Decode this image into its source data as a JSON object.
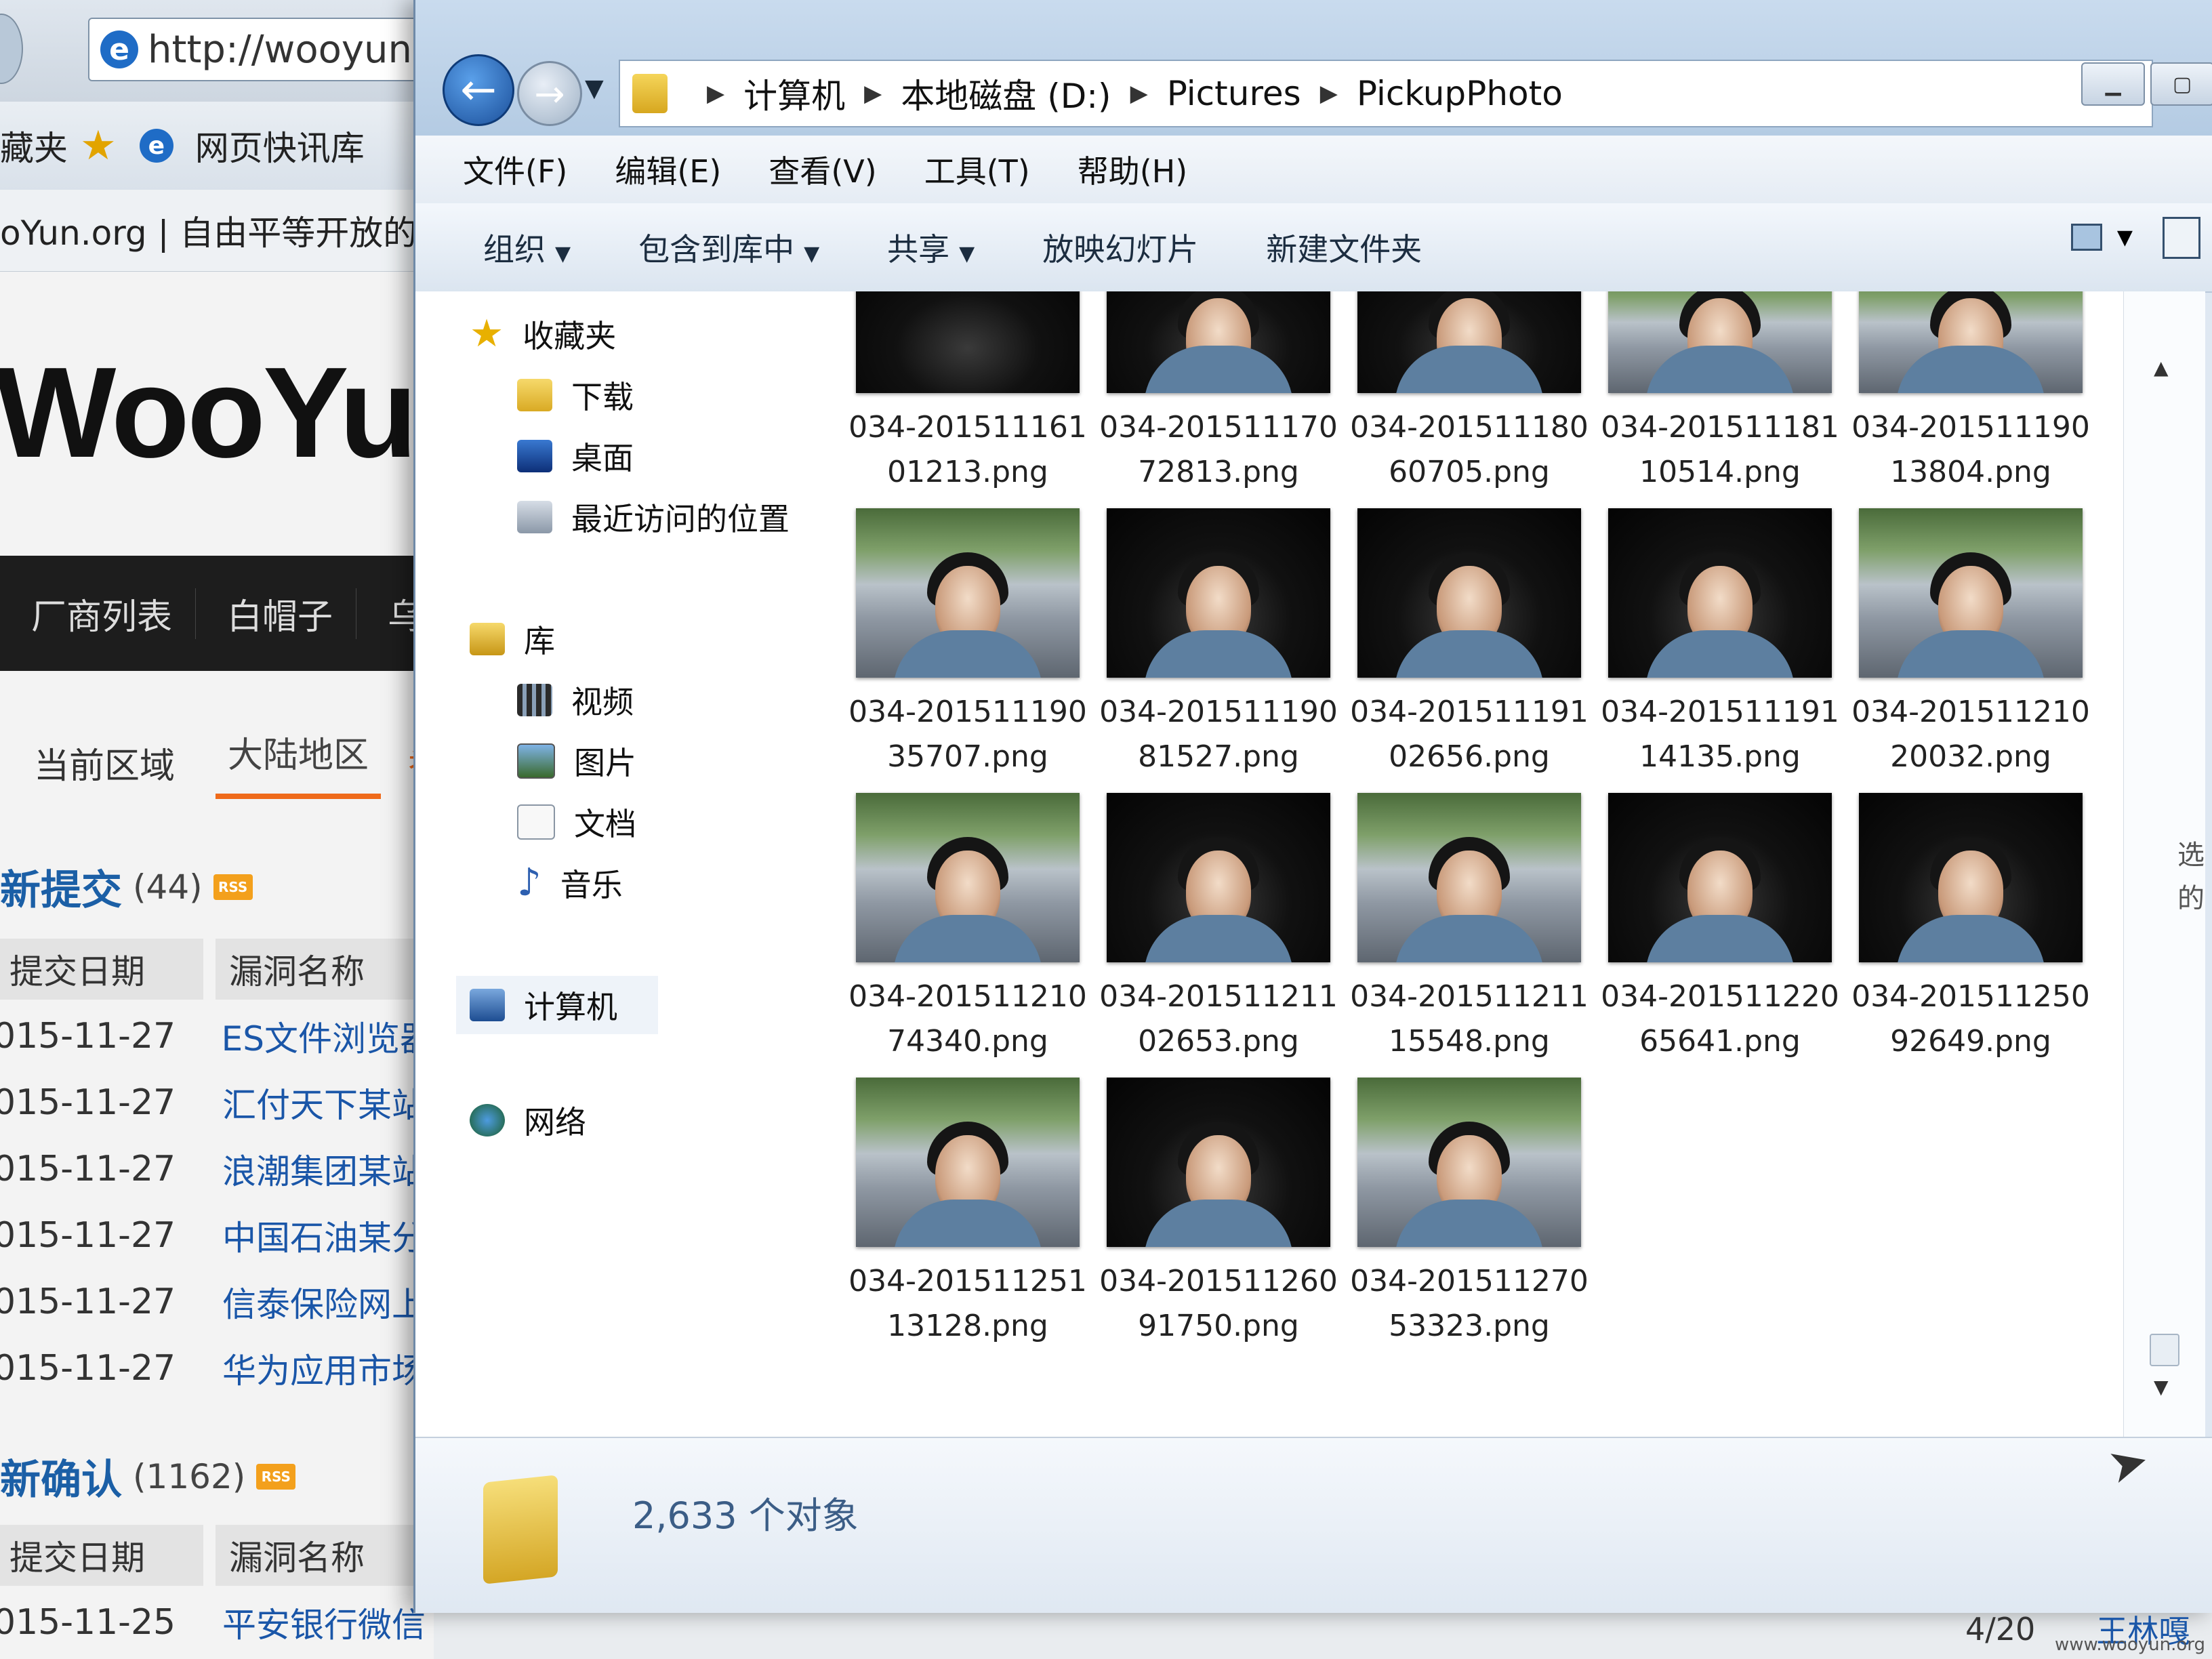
{
  "browser": {
    "url": "http://wooyun.or",
    "fav_left": "藏夹",
    "fav_item": "网页快讯库",
    "tab_title": "oYun.org | 自由平等开放的漏",
    "logo": "WooYun",
    "nav": [
      "厂商列表",
      "白帽子",
      "乌"
    ],
    "region_label": "当前区域",
    "region_active": "大陆地区",
    "region_next": "香",
    "new_submit": {
      "title": "新提交",
      "count": "(44)"
    },
    "new_confirm": {
      "title": "新确认",
      "count": "(1162)"
    },
    "rss": "RSS",
    "col_date": "提交日期",
    "col_name": "漏洞名称",
    "submit_rows": [
      {
        "date": "015-11-27",
        "name": "ES文件浏览器"
      },
      {
        "date": "015-11-27",
        "name": "汇付天下某站"
      },
      {
        "date": "015-11-27",
        "name": "浪潮集团某站"
      },
      {
        "date": "015-11-27",
        "name": "中国石油某分"
      },
      {
        "date": "015-11-27",
        "name": "信泰保险网上"
      },
      {
        "date": "015-11-27",
        "name": "华为应用市场"
      }
    ],
    "confirm_rows": [
      {
        "date": "015-11-25",
        "name": "平安银行微信"
      }
    ]
  },
  "explorer": {
    "breadcrumb": [
      "计算机",
      "本地磁盘 (D:)",
      "Pictures",
      "PickupPhoto"
    ],
    "menu": [
      "文件(F)",
      "编辑(E)",
      "查看(V)",
      "工具(T)",
      "帮助(H)"
    ],
    "commands": [
      {
        "label": "组织",
        "dropdown": true
      },
      {
        "label": "包含到库中",
        "dropdown": true
      },
      {
        "label": "共享",
        "dropdown": true
      },
      {
        "label": "放映幻灯片",
        "dropdown": false
      },
      {
        "label": "新建文件夹",
        "dropdown": false
      }
    ],
    "nav": {
      "favorites": "收藏夹",
      "downloads": "下载",
      "desktop": "桌面",
      "recent": "最近访问的位置",
      "libraries": "库",
      "videos": "视频",
      "pictures": "图片",
      "documents": "文档",
      "music": "音乐",
      "computer": "计算机",
      "network": "网络"
    },
    "files": [
      {
        "l1": "034-201511161",
        "l2": "01213.png",
        "scene": "dark",
        "face": false
      },
      {
        "l1": "034-201511170",
        "l2": "72813.png",
        "scene": "dark",
        "face": true
      },
      {
        "l1": "034-201511180",
        "l2": "60705.png",
        "scene": "dark",
        "face": true
      },
      {
        "l1": "034-201511181",
        "l2": "10514.png",
        "scene": "outdoor",
        "face": true
      },
      {
        "l1": "034-201511190",
        "l2": "13804.png",
        "scene": "outdoor",
        "face": true
      },
      {
        "l1": "034-201511190",
        "l2": "35707.png",
        "scene": "outdoor",
        "face": true
      },
      {
        "l1": "034-201511190",
        "l2": "81527.png",
        "scene": "dark",
        "face": true
      },
      {
        "l1": "034-201511191",
        "l2": "02656.png",
        "scene": "dark",
        "face": true
      },
      {
        "l1": "034-201511191",
        "l2": "14135.png",
        "scene": "dark",
        "face": true
      },
      {
        "l1": "034-201511210",
        "l2": "20032.png",
        "scene": "outdoor",
        "face": true
      },
      {
        "l1": "034-201511210",
        "l2": "74340.png",
        "scene": "outdoor",
        "face": true
      },
      {
        "l1": "034-201511211",
        "l2": "02653.png",
        "scene": "dark",
        "face": true
      },
      {
        "l1": "034-201511211",
        "l2": "15548.png",
        "scene": "outdoor",
        "face": true
      },
      {
        "l1": "034-201511220",
        "l2": "65641.png",
        "scene": "dark",
        "face": true
      },
      {
        "l1": "034-201511250",
        "l2": "92649.png",
        "scene": "dark",
        "face": true
      },
      {
        "l1": "034-201511251",
        "l2": "13128.png",
        "scene": "outdoor",
        "face": true
      },
      {
        "l1": "034-201511260",
        "l2": "91750.png",
        "scene": "dark",
        "face": true
      },
      {
        "l1": "034-201511270",
        "l2": "53323.png",
        "scene": "outdoor",
        "face": true
      }
    ],
    "side_text": [
      "选",
      "的"
    ],
    "status_count": "2,633 个对象"
  },
  "taskbar": {
    "page": "4/20",
    "name": "王林嘎"
  },
  "watermark": "www.wooyun.org",
  "colors": {
    "accent": "#ef6a1a",
    "link": "#1a56a8",
    "dark_bar": "#1d1d1d"
  }
}
